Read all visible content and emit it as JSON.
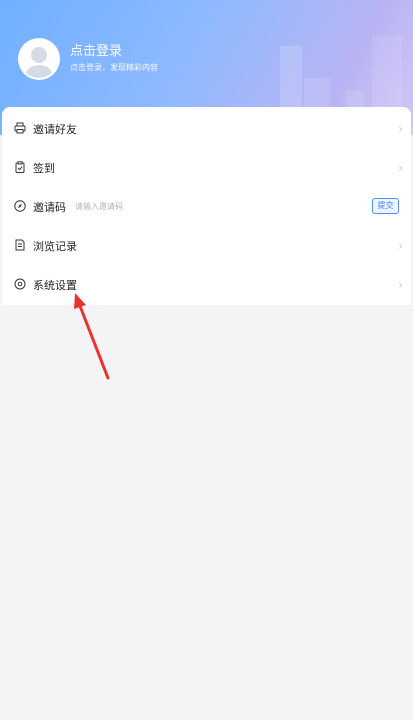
{
  "header": {
    "login_title": "点击登录",
    "login_subtitle": "点击登录，发现精彩内容"
  },
  "menu": {
    "invite_friends": "邀请好友",
    "sign_in": "签到",
    "invite_code": {
      "label": "邀请码",
      "placeholder": "请输入邀请码",
      "submit_label": "提交"
    },
    "browse_history": "浏览记录",
    "system_settings": "系统设置",
    "chevron": "›"
  },
  "annotation": {
    "arrow_color": "#e8332f"
  },
  "icons": {
    "invite_friends": "printer-icon",
    "sign_in": "clipboard-check-icon",
    "invite_code": "compass-icon",
    "browse_history": "document-icon",
    "system_settings": "gear-icon"
  }
}
